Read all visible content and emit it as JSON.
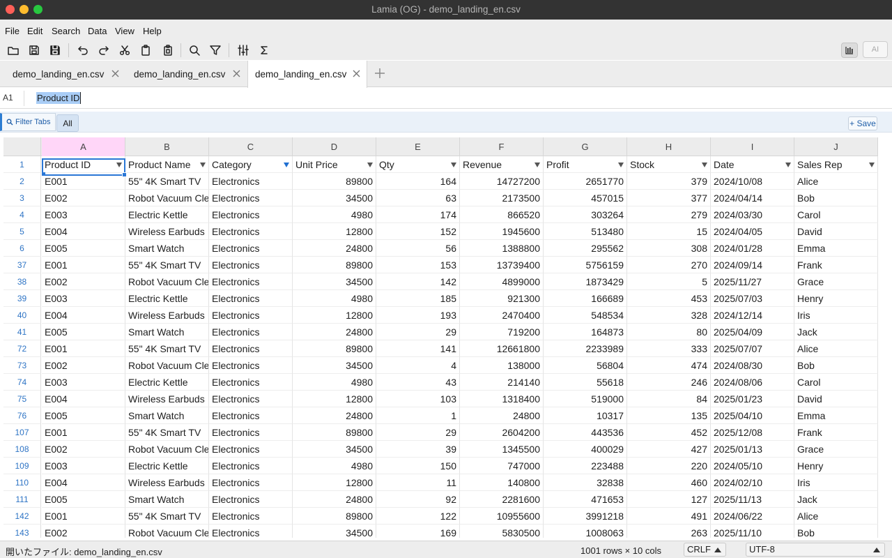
{
  "window": {
    "title": "Lamia (OG) - demo_landing_en.csv"
  },
  "menu": [
    "File",
    "Edit",
    "Search",
    "Data",
    "View",
    "Help"
  ],
  "toolbar": {
    "icons": [
      "open-folder-icon",
      "save-icon",
      "save-as-icon",
      "undo-icon",
      "redo-icon",
      "cut-icon",
      "copy-icon",
      "paste-icon",
      "search-icon",
      "filter-icon",
      "column-settings-icon",
      "sum-icon"
    ],
    "ai_label": "AI"
  },
  "tabs": [
    {
      "label": "demo_landing_en.csv",
      "active": false
    },
    {
      "label": "demo_landing_en.csv",
      "active": false
    },
    {
      "label": "demo_landing_en.csv",
      "active": true
    }
  ],
  "formula": {
    "cell_ref": "A1",
    "value": "Product ID"
  },
  "filter_bar": {
    "filter_tabs_label": "Filter Tabs",
    "all_label": "All",
    "save_label": "+ Save"
  },
  "grid": {
    "columns": [
      "A",
      "B",
      "C",
      "D",
      "E",
      "F",
      "G",
      "H",
      "I",
      "J"
    ],
    "header_row_number": "1",
    "headers": [
      "Product ID",
      "Product Name",
      "Category",
      "Unit Price",
      "Qty",
      "Revenue",
      "Profit",
      "Stock",
      "Date",
      "Sales Rep"
    ],
    "active_filter_column": 2,
    "selected_cell": "A1",
    "rows": [
      {
        "n": "2",
        "cells": [
          "E001",
          "55\" 4K Smart TV",
          "Electronics",
          "89800",
          "164",
          "14727200",
          "2651770",
          "379",
          "2024/10/08",
          "Alice"
        ]
      },
      {
        "n": "3",
        "cells": [
          "E002",
          "Robot Vacuum Cle",
          "Electronics",
          "34500",
          "63",
          "2173500",
          "457015",
          "377",
          "2024/04/14",
          "Bob"
        ]
      },
      {
        "n": "4",
        "cells": [
          "E003",
          "Electric Kettle",
          "Electronics",
          "4980",
          "174",
          "866520",
          "303264",
          "279",
          "2024/03/30",
          "Carol"
        ]
      },
      {
        "n": "5",
        "cells": [
          "E004",
          "Wireless Earbuds",
          "Electronics",
          "12800",
          "152",
          "1945600",
          "513480",
          "15",
          "2024/04/05",
          "David"
        ]
      },
      {
        "n": "6",
        "cells": [
          "E005",
          "Smart Watch",
          "Electronics",
          "24800",
          "56",
          "1388800",
          "295562",
          "308",
          "2024/01/28",
          "Emma"
        ]
      },
      {
        "n": "37",
        "cells": [
          "E001",
          "55\" 4K Smart TV",
          "Electronics",
          "89800",
          "153",
          "13739400",
          "5756159",
          "270",
          "2024/09/14",
          "Frank"
        ]
      },
      {
        "n": "38",
        "cells": [
          "E002",
          "Robot Vacuum Cle",
          "Electronics",
          "34500",
          "142",
          "4899000",
          "1873429",
          "5",
          "2025/11/27",
          "Grace"
        ]
      },
      {
        "n": "39",
        "cells": [
          "E003",
          "Electric Kettle",
          "Electronics",
          "4980",
          "185",
          "921300",
          "166689",
          "453",
          "2025/07/03",
          "Henry"
        ]
      },
      {
        "n": "40",
        "cells": [
          "E004",
          "Wireless Earbuds",
          "Electronics",
          "12800",
          "193",
          "2470400",
          "548534",
          "328",
          "2024/12/14",
          "Iris"
        ]
      },
      {
        "n": "41",
        "cells": [
          "E005",
          "Smart Watch",
          "Electronics",
          "24800",
          "29",
          "719200",
          "164873",
          "80",
          "2025/04/09",
          "Jack"
        ]
      },
      {
        "n": "72",
        "cells": [
          "E001",
          "55\" 4K Smart TV",
          "Electronics",
          "89800",
          "141",
          "12661800",
          "2233989",
          "333",
          "2025/07/07",
          "Alice"
        ]
      },
      {
        "n": "73",
        "cells": [
          "E002",
          "Robot Vacuum Cle",
          "Electronics",
          "34500",
          "4",
          "138000",
          "56804",
          "474",
          "2024/08/30",
          "Bob"
        ]
      },
      {
        "n": "74",
        "cells": [
          "E003",
          "Electric Kettle",
          "Electronics",
          "4980",
          "43",
          "214140",
          "55618",
          "246",
          "2024/08/06",
          "Carol"
        ]
      },
      {
        "n": "75",
        "cells": [
          "E004",
          "Wireless Earbuds",
          "Electronics",
          "12800",
          "103",
          "1318400",
          "519000",
          "84",
          "2025/01/23",
          "David"
        ]
      },
      {
        "n": "76",
        "cells": [
          "E005",
          "Smart Watch",
          "Electronics",
          "24800",
          "1",
          "24800",
          "10317",
          "135",
          "2025/04/10",
          "Emma"
        ]
      },
      {
        "n": "107",
        "cells": [
          "E001",
          "55\" 4K Smart TV",
          "Electronics",
          "89800",
          "29",
          "2604200",
          "443536",
          "452",
          "2025/12/08",
          "Frank"
        ]
      },
      {
        "n": "108",
        "cells": [
          "E002",
          "Robot Vacuum Cle",
          "Electronics",
          "34500",
          "39",
          "1345500",
          "400029",
          "427",
          "2025/01/13",
          "Grace"
        ]
      },
      {
        "n": "109",
        "cells": [
          "E003",
          "Electric Kettle",
          "Electronics",
          "4980",
          "150",
          "747000",
          "223488",
          "220",
          "2024/05/10",
          "Henry"
        ]
      },
      {
        "n": "110",
        "cells": [
          "E004",
          "Wireless Earbuds",
          "Electronics",
          "12800",
          "11",
          "140800",
          "32838",
          "460",
          "2024/02/10",
          "Iris"
        ]
      },
      {
        "n": "111",
        "cells": [
          "E005",
          "Smart Watch",
          "Electronics",
          "24800",
          "92",
          "2281600",
          "471653",
          "127",
          "2025/11/13",
          "Jack"
        ]
      },
      {
        "n": "142",
        "cells": [
          "E001",
          "55\" 4K Smart TV",
          "Electronics",
          "89800",
          "122",
          "10955600",
          "3991218",
          "491",
          "2024/06/22",
          "Alice"
        ]
      },
      {
        "n": "143",
        "cells": [
          "E002",
          "Robot Vacuum Cle",
          "Electronics",
          "34500",
          "169",
          "5830500",
          "1008063",
          "263",
          "2025/11/10",
          "Bob"
        ]
      }
    ]
  },
  "status": {
    "file_label": "開いたファイル: demo_landing_en.csv",
    "rows_cols": "1001 rows × 10 cols",
    "line_ending": "CRLF",
    "encoding": "UTF-8"
  },
  "colors": {
    "accent": "#2a77d6",
    "selected_column_header": "#ffd6f8",
    "row_number": "#2e74c5"
  }
}
